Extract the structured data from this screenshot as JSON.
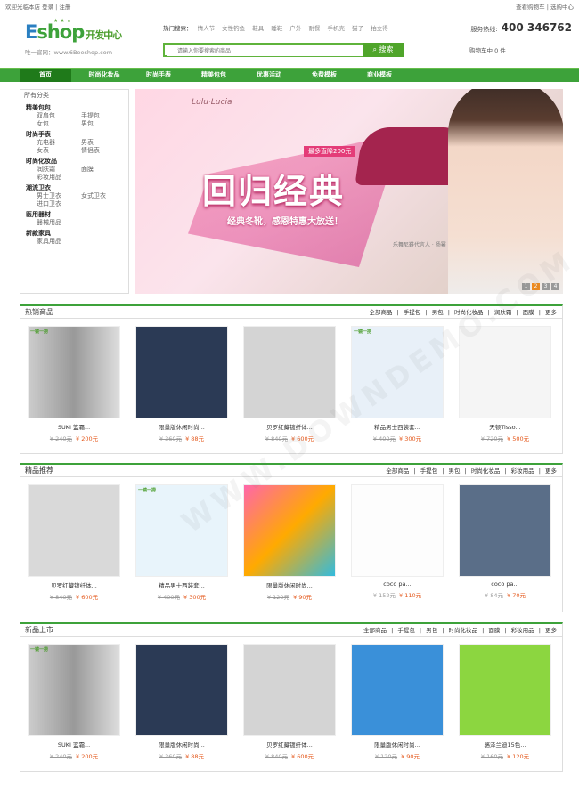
{
  "topbar": {
    "left": "欢迎光临本店 登录 | 注册",
    "right": "查看购物车 | 选购中心"
  },
  "logo": {
    "main": "E",
    "main2": "shop",
    "sub": "唯一官网：www.6Beeshop.com",
    "cn": "开发中心"
  },
  "hot": {
    "label": "热门搜索：",
    "keywords": [
      "情人节",
      "女性钓鱼",
      "鞋具",
      "睡鞋",
      "户外",
      "耐餐",
      "手机壳",
      "猫子",
      "拍立得"
    ]
  },
  "search": {
    "placeholder": "请输入你要搜索的商品",
    "button": "搜索"
  },
  "service": {
    "label": "服务热线:",
    "phone": "400 346762"
  },
  "cart": "购物车中  0 件",
  "nav": [
    "首页",
    "时尚化妆品",
    "时尚手表",
    "精美包包",
    "优惠活动",
    "免费模板",
    "商业模板"
  ],
  "cats": {
    "title": "所有分类",
    "groups": [
      {
        "name": "精美包包",
        "rows": [
          [
            "双肩包",
            "手提包"
          ],
          [
            "女包",
            "男包"
          ]
        ]
      },
      {
        "name": "时尚手表",
        "rows": [
          [
            "充电器",
            "男表"
          ],
          [
            "女表",
            "情侣表"
          ]
        ]
      },
      {
        "name": "时尚化妆品",
        "rows": [
          [
            "润肤霜",
            "面膜"
          ],
          [
            "彩妆用品",
            ""
          ]
        ]
      },
      {
        "name": "潮流卫衣",
        "rows": [
          [
            "男士卫衣",
            "女式卫衣"
          ],
          [
            "进口卫衣",
            ""
          ]
        ]
      },
      {
        "name": "医用器材",
        "rows": [
          [
            "器械用品",
            ""
          ]
        ]
      },
      {
        "name": "新款家具",
        "rows": [
          [
            "家具用品",
            ""
          ]
        ]
      }
    ]
  },
  "banner": {
    "title": "回归经典",
    "sub": "经典冬靴，感恩特惠大放送！",
    "tag": "最多直降200元",
    "brand": "Lulu·Lucia",
    "sig": "乐舞尼鞋代言人 · 杨幂",
    "dots": [
      "1",
      "2",
      "3",
      "4"
    ]
  },
  "sections": [
    {
      "title": "热销商品",
      "links": [
        "全部商品",
        "手提包",
        "男包",
        "时尚化妆品",
        "润肤霜",
        "面膜",
        "更多"
      ],
      "products": [
        {
          "name": "SUKI 篮霜...",
          "old": "¥ 240元",
          "price": "¥ 200元"
        },
        {
          "name": "限量版休闲时尚...",
          "old": "¥ 360元",
          "price": "¥ 88元"
        },
        {
          "name": "贝罗红藏镀纤体...",
          "old": "¥ 840元",
          "price": "¥ 600元"
        },
        {
          "name": "精品男士西装套...",
          "old": "¥ 400元",
          "price": "¥ 300元"
        },
        {
          "name": "天顿Tisso...",
          "old": "¥ 720元",
          "price": "¥ 500元"
        }
      ]
    },
    {
      "title": "精品推荐",
      "links": [
        "全部商品",
        "手提包",
        "男包",
        "时尚化妆品",
        "彩妆用品",
        "更多"
      ],
      "products": [
        {
          "name": "贝罗红藏镀纤体...",
          "old": "¥ 840元",
          "price": "¥ 600元"
        },
        {
          "name": "精品男士西装套...",
          "old": "¥ 400元",
          "price": "¥ 300元"
        },
        {
          "name": "限量版休闲时尚...",
          "old": "¥ 120元",
          "price": "¥ 90元"
        },
        {
          "name": "coco pa...",
          "old": "¥ 152元",
          "price": "¥ 110元"
        },
        {
          "name": "coco pa...",
          "old": "¥ 84元",
          "price": "¥ 70元"
        }
      ]
    },
    {
      "title": "新品上市",
      "links": [
        "全部商品",
        "手提包",
        "男包",
        "时尚化妆品",
        "面膜",
        "彩妆用品",
        "更多"
      ],
      "products": [
        {
          "name": "SUKI 篮霜...",
          "old": "¥ 240元",
          "price": "¥ 200元"
        },
        {
          "name": "限量版休闲时尚...",
          "old": "¥ 360元",
          "price": "¥ 88元"
        },
        {
          "name": "贝罗红藏镀纤体...",
          "old": "¥ 840元",
          "price": "¥ 600元"
        },
        {
          "name": "限量版休闲时尚...",
          "old": "¥ 120元",
          "price": "¥ 90元"
        },
        {
          "name": "骆泽兰迪15色...",
          "old": "¥ 160元",
          "price": "¥ 120元"
        }
      ]
    }
  ],
  "badge": "一镜一捞",
  "watermark": "WWW.DOWNDEMO.COM",
  "colors": {
    "brand": "#3da23a",
    "nav_dark": "#1f7a1a",
    "price": "#e4571a"
  }
}
